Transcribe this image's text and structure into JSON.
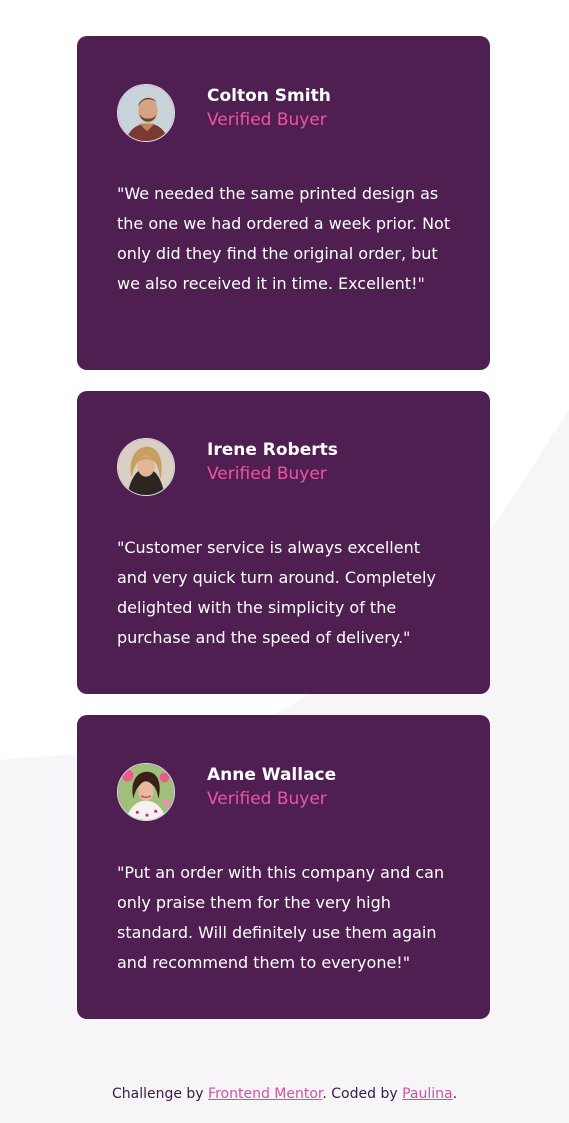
{
  "testimonials": [
    {
      "name": "Colton Smith",
      "status": "Verified Buyer",
      "quote": "\"We needed the same printed design as the one we had ordered a week prior. Not only did they find the original order, but we also received it in time. Excellent!\"",
      "avatar": "man-with-beard-avatar"
    },
    {
      "name": "Irene Roberts",
      "status": "Verified Buyer",
      "quote": "\"Customer service is always excellent and very quick turn around. Completely delighted with the simplicity of the purchase and the speed of delivery.\"",
      "avatar": "blonde-woman-avatar"
    },
    {
      "name": "Anne Wallace",
      "status": "Verified Buyer",
      "quote": "\"Put an order with this company and can only praise them for the very high standard. Will definitely use them again and recommend them to everyone!\"",
      "avatar": "dark-haired-woman-avatar"
    }
  ],
  "footer": {
    "prefix": "Challenge by ",
    "link1": "Frontend Mentor",
    "middle": ". Coded by ",
    "link2": "Paulina",
    "suffix": "."
  },
  "colors": {
    "card": "#4f1f51",
    "accent": "#ec55a5",
    "text": "#ffffff",
    "background": "#ffffff"
  }
}
